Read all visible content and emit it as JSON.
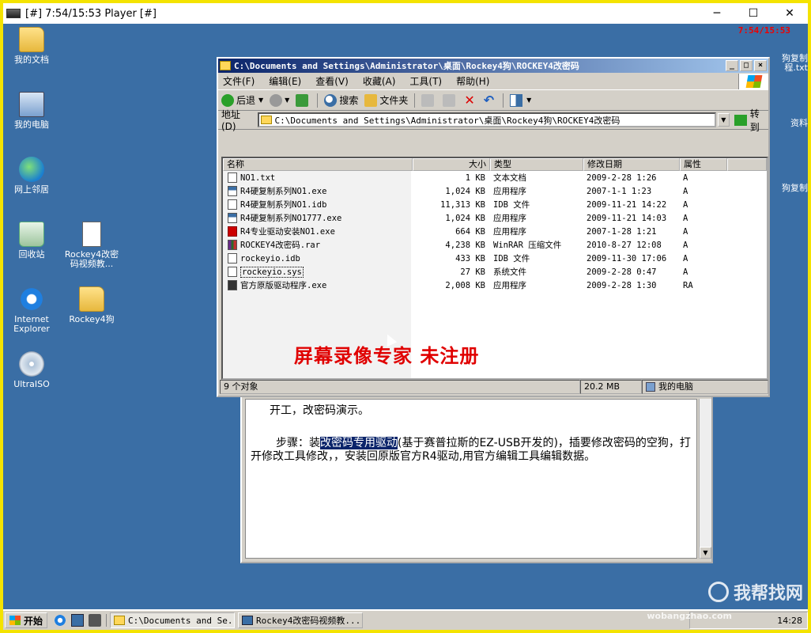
{
  "player": {
    "title": "[#] 7:54/15:53 Player [#]",
    "minimize": "─",
    "maximize": "☐",
    "close": "✕"
  },
  "recording_time": "7:54/15:53",
  "desktop_icons": [
    {
      "label": "我的文档",
      "icon": "folder-icon"
    },
    {
      "label": "我的电脑",
      "icon": "computer-icon"
    },
    {
      "label": "网上邻居",
      "icon": "network-icon"
    },
    {
      "label": "回收站",
      "icon": "recycle-bin-icon"
    },
    {
      "label": "Rockey4改密码视频教...",
      "icon": "document-icon"
    },
    {
      "label": "Internet Explorer",
      "icon": "ie-icon"
    },
    {
      "label": "Rockey4狗",
      "icon": "folder-icon"
    },
    {
      "label": "UltraISO",
      "icon": "disc-icon"
    }
  ],
  "right_edge": {
    "item1_line1": "狗复制",
    "item1_line2": "程.txt",
    "item2": "资料",
    "item3": "狗复制"
  },
  "explorer": {
    "title": "C:\\Documents and Settings\\Administrator\\桌面\\Rockey4狗\\ROCKEY4改密码",
    "menu": [
      "文件(F)",
      "编辑(E)",
      "查看(V)",
      "收藏(A)",
      "工具(T)",
      "帮助(H)"
    ],
    "toolbar": {
      "back": "后退",
      "search": "搜索",
      "folders": "文件夹"
    },
    "address_label": "地址(D)",
    "address_value": "C:\\Documents and Settings\\Administrator\\桌面\\Rockey4狗\\ROCKEY4改密码",
    "go_label": "转到",
    "columns": [
      "名称",
      "大小",
      "类型",
      "修改日期",
      "属性"
    ],
    "files": [
      {
        "name": "NO1.txt",
        "size": "1 KB",
        "type": "文本文档",
        "date": "2009-2-28 1:26",
        "attr": "A",
        "icon": "text-file-icon"
      },
      {
        "name": "R4硬复制系列NO1.exe",
        "size": "1,024 KB",
        "type": "应用程序",
        "date": "2007-1-1 1:23",
        "attr": "A",
        "icon": "exe-file-icon"
      },
      {
        "name": "R4硬复制系列NO1.idb",
        "size": "11,313 KB",
        "type": "IDB 文件",
        "date": "2009-11-21 14:22",
        "attr": "A",
        "icon": "idb-file-icon"
      },
      {
        "name": "R4硬复制系列NO1777.exe",
        "size": "1,024 KB",
        "type": "应用程序",
        "date": "2009-11-21 14:03",
        "attr": "A",
        "icon": "exe-file-icon"
      },
      {
        "name": "R4专业驱动安装NO1.exe",
        "size": "664 KB",
        "type": "应用程序",
        "date": "2007-1-28 1:21",
        "attr": "A",
        "icon": "installer-icon"
      },
      {
        "name": "ROCKEY4改密码.rar",
        "size": "4,238 KB",
        "type": "WinRAR 压缩文件",
        "date": "2010-8-27 12:08",
        "attr": "A",
        "icon": "rar-file-icon"
      },
      {
        "name": "rockeyio.idb",
        "size": "433 KB",
        "type": "IDB 文件",
        "date": "2009-11-30 17:06",
        "attr": "A",
        "icon": "idb-file-icon"
      },
      {
        "name": "rockeyio.sys",
        "size": "27 KB",
        "type": "系统文件",
        "date": "2009-2-28 0:47",
        "attr": "A",
        "icon": "sys-file-icon"
      },
      {
        "name": "官方原版驱动程序.exe",
        "size": "2,008 KB",
        "type": "应用程序",
        "date": "2009-2-28 1:30",
        "attr": "RA",
        "icon": "exe-file-icon"
      }
    ],
    "watermark": "屏幕录像专家 未注册",
    "status_count": "9 个对象",
    "status_size": "20.2 MB",
    "status_location": "我的电脑"
  },
  "document": {
    "line1": "开工，改密码演示。",
    "para_prefix": "步骤：装",
    "para_highlight": "改密码专用驱动",
    "para_rest": "(基于赛普拉斯的EZ-USB开发的)，插要修改密码的空狗，打开修改工具修改，，安装回原版官方R4驱动,用官方编辑工具编辑数据。"
  },
  "taskbar": {
    "start": "开始",
    "task1": "C:\\Documents and Se...",
    "task2": "Rockey4改密码视频教...",
    "tray_time": "14:28"
  },
  "site_watermark": "我帮找网",
  "site_watermark_url": "wobangzhao.com"
}
